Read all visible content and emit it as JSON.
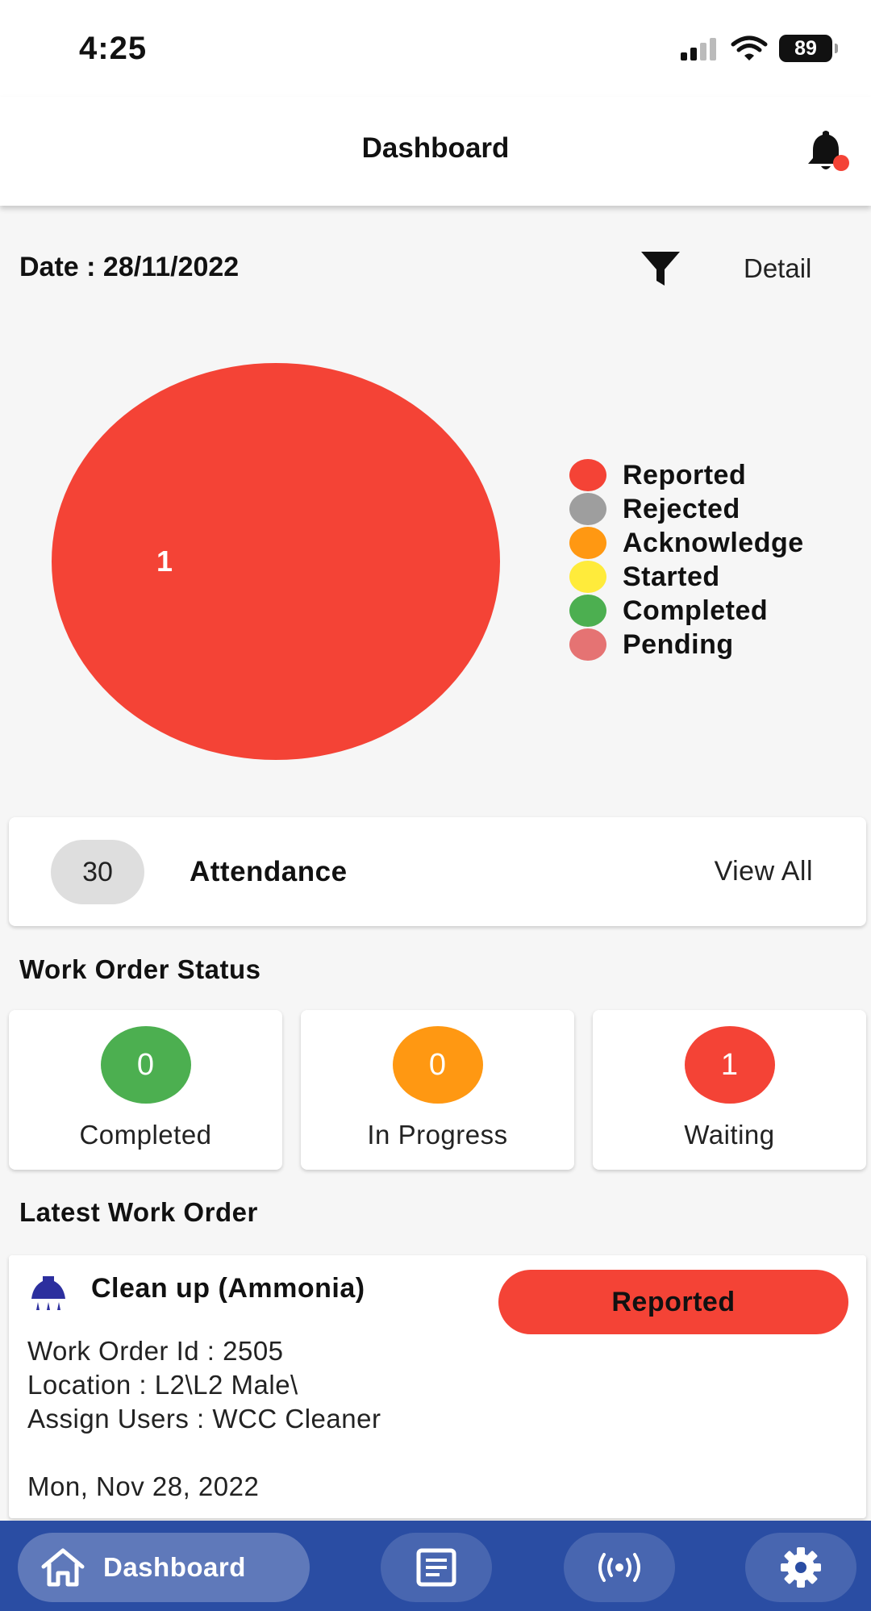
{
  "status_bar": {
    "time": "4:25",
    "battery": "89"
  },
  "header": {
    "title": "Dashboard"
  },
  "filter_row": {
    "date_label": "Date : 28/11/2022",
    "detail_label": "Detail"
  },
  "chart_data": {
    "type": "pie",
    "categories": [
      "Reported",
      "Rejected",
      "Acknowledge",
      "Started",
      "Completed",
      "Pending"
    ],
    "values": [
      1,
      0,
      0,
      0,
      0,
      0
    ],
    "colors": [
      "#f44336",
      "#9e9e9e",
      "#ff9812",
      "#ffeb3b",
      "#4caf50",
      "#e57373"
    ],
    "legend_position": "right",
    "data_labels": [
      "1"
    ]
  },
  "attendance": {
    "count": "30",
    "title": "Attendance",
    "view_all": "View All"
  },
  "work_order_status": {
    "title": "Work Order Status",
    "items": [
      {
        "count": "0",
        "label": "Completed",
        "color": "#4caf50"
      },
      {
        "count": "0",
        "label": "In Progress",
        "color": "#ff9812"
      },
      {
        "count": "1",
        "label": "Waiting",
        "color": "#f44336"
      }
    ]
  },
  "latest_work_order": {
    "section_title": "Latest Work Order",
    "title": "Clean up (Ammonia)",
    "status": "Reported",
    "id_line": "Work Order Id : 2505",
    "location_line": "Location : L2\\L2 Male\\",
    "users_line": "Assign Users : WCC Cleaner",
    "date_line": "Mon, Nov 28, 2022"
  },
  "bottom_nav": {
    "active_label": "Dashboard",
    "bg_color": "#2a4da3"
  }
}
